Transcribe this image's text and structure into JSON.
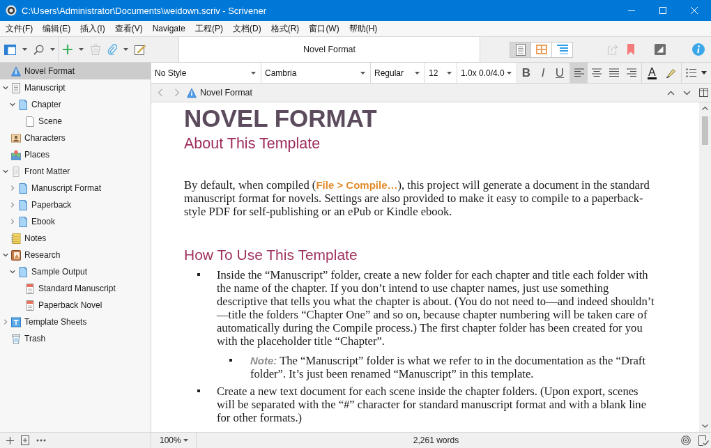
{
  "window": {
    "title": "C:\\Users\\Administrator\\Documents\\weidown.scriv - Scrivener"
  },
  "menu": [
    "文件(F)",
    "编辑(E)",
    "插入(I)",
    "查看(V)",
    "Navigate",
    "工程(P)",
    "文档(D)",
    "格式(R)",
    "窗口(W)",
    "帮助(H)"
  ],
  "toolbar": {
    "button_groups": [
      {
        "buttons": [
          {
            "kind": "layout",
            "dropdown": true,
            "disabled": false
          },
          {
            "kind": "search",
            "dropdown": true,
            "disabled": false
          }
        ]
      },
      {
        "buttons": [
          {
            "kind": "add",
            "dropdown": true,
            "disabled": false
          },
          {
            "kind": "trash",
            "dropdown": false,
            "disabled": true
          },
          {
            "kind": "attach",
            "dropdown": true,
            "disabled": false
          },
          {
            "kind": "edit",
            "dropdown": false,
            "disabled": false
          }
        ]
      }
    ],
    "title": "Novel Format",
    "view_modes": [
      {
        "kind": "document",
        "selected": true
      },
      {
        "kind": "corkboard",
        "selected": false
      },
      {
        "kind": "outline",
        "selected": false
      }
    ],
    "right_buttons": [
      {
        "kind": "share",
        "disabled": true
      },
      {
        "kind": "bookmark",
        "disabled": false
      },
      {
        "kind": "composition",
        "disabled": false
      },
      {
        "kind": "info",
        "disabled": false
      }
    ]
  },
  "binder": {
    "items": [
      {
        "label": "Novel Format",
        "kind": "triangle",
        "selected": true
      },
      {
        "label": "Manuscript",
        "kind": "document",
        "selected": false,
        "expanded": true,
        "children": [
          {
            "label": "Chapter",
            "kind": "folder",
            "selected": false,
            "expanded": true,
            "children": [
              {
                "label": "Scene",
                "kind": "blank",
                "selected": false
              }
            ]
          }
        ]
      },
      {
        "label": "Characters",
        "kind": "characters",
        "selected": false
      },
      {
        "label": "Places",
        "kind": "places",
        "selected": false
      },
      {
        "label": "Front Matter",
        "kind": "front-matter",
        "selected": false,
        "expanded": true,
        "children": [
          {
            "label": "Manuscript Format",
            "kind": "folder",
            "selected": false,
            "expanded": false
          },
          {
            "label": "Paperback",
            "kind": "folder",
            "selected": false,
            "expanded": false
          },
          {
            "label": "Ebook",
            "kind": "folder",
            "selected": false,
            "expanded": false
          }
        ]
      },
      {
        "label": "Notes",
        "kind": "notes",
        "selected": false
      },
      {
        "label": "Research",
        "kind": "research",
        "selected": false,
        "expanded": true,
        "children": [
          {
            "label": "Sample Output",
            "kind": "folder",
            "selected": false,
            "expanded": true,
            "children": [
              {
                "label": "Standard Manuscript",
                "kind": "pdf",
                "selected": false
              },
              {
                "label": "Paperback Novel",
                "kind": "pdf",
                "selected": false
              }
            ]
          }
        ]
      },
      {
        "label": "Template Sheets",
        "kind": "templates",
        "selected": false,
        "expanded": false
      },
      {
        "label": "Trash",
        "kind": "trash",
        "selected": false
      }
    ]
  },
  "format_bar": {
    "paragraph_style": "No Style",
    "font_family": "Cambria",
    "font_style": "Regular",
    "font_size": "12",
    "line_spacing": "1.0x 0.0/4.0",
    "style_buttons": [
      {
        "kind": "bold",
        "label": "B"
      },
      {
        "kind": "italic",
        "label": "I"
      },
      {
        "kind": "underline",
        "label": "U"
      }
    ],
    "alignments": [
      {
        "kind": "left",
        "selected": true
      },
      {
        "kind": "center",
        "selected": false
      },
      {
        "kind": "justify",
        "selected": false
      },
      {
        "kind": "right",
        "selected": false
      }
    ],
    "text_color": "A"
  },
  "header_bar": {
    "nav": [
      {
        "kind": "back",
        "disabled": true
      },
      {
        "kind": "forward",
        "disabled": true
      }
    ],
    "title": "Novel Format"
  },
  "document": {
    "title": "NOVEL FORMAT",
    "subtitle": "About This Template",
    "intro": "By default, when compiled (**File > Compile…**), this project will generate a document in the standard manuscript format for novels. Settings are also provided to make it easy to compile to a paperback-style PDF for self-publishing or an ePub or Kindle ebook.",
    "sections": [
      {
        "heading": "How To Use This Template",
        "bullets": [
          {
            "text": "Inside the “Manuscript” folder, create a new folder for each chapter and title each folder with the name of the chapter. If you don’t intend to use chapter names, just use something descriptive that tells you what the chapter is about. (You do not need to—and indeed shouldn’t—title the folders “Chapter One” and so on, because chapter numbering will be taken care of automatically during the Compile process.) The first chapter folder has been created for you with the placeholder title “Chapter”.",
            "children": [
              {
                "text": "*Note:* The “Manuscript” folder is what we refer to in the documentation as the “Draft folder”. It’s just been renamed “Manuscript” in this template."
              }
            ]
          },
          {
            "text": "Create a new text document for each scene inside the chapter folders. (Upon export, scenes will be separated with the “#” character for standard manuscript format and with a blank line for other formats.)"
          }
        ]
      }
    ]
  },
  "status_bar": {
    "zoom": "100%",
    "word_count": "2,261 words"
  }
}
